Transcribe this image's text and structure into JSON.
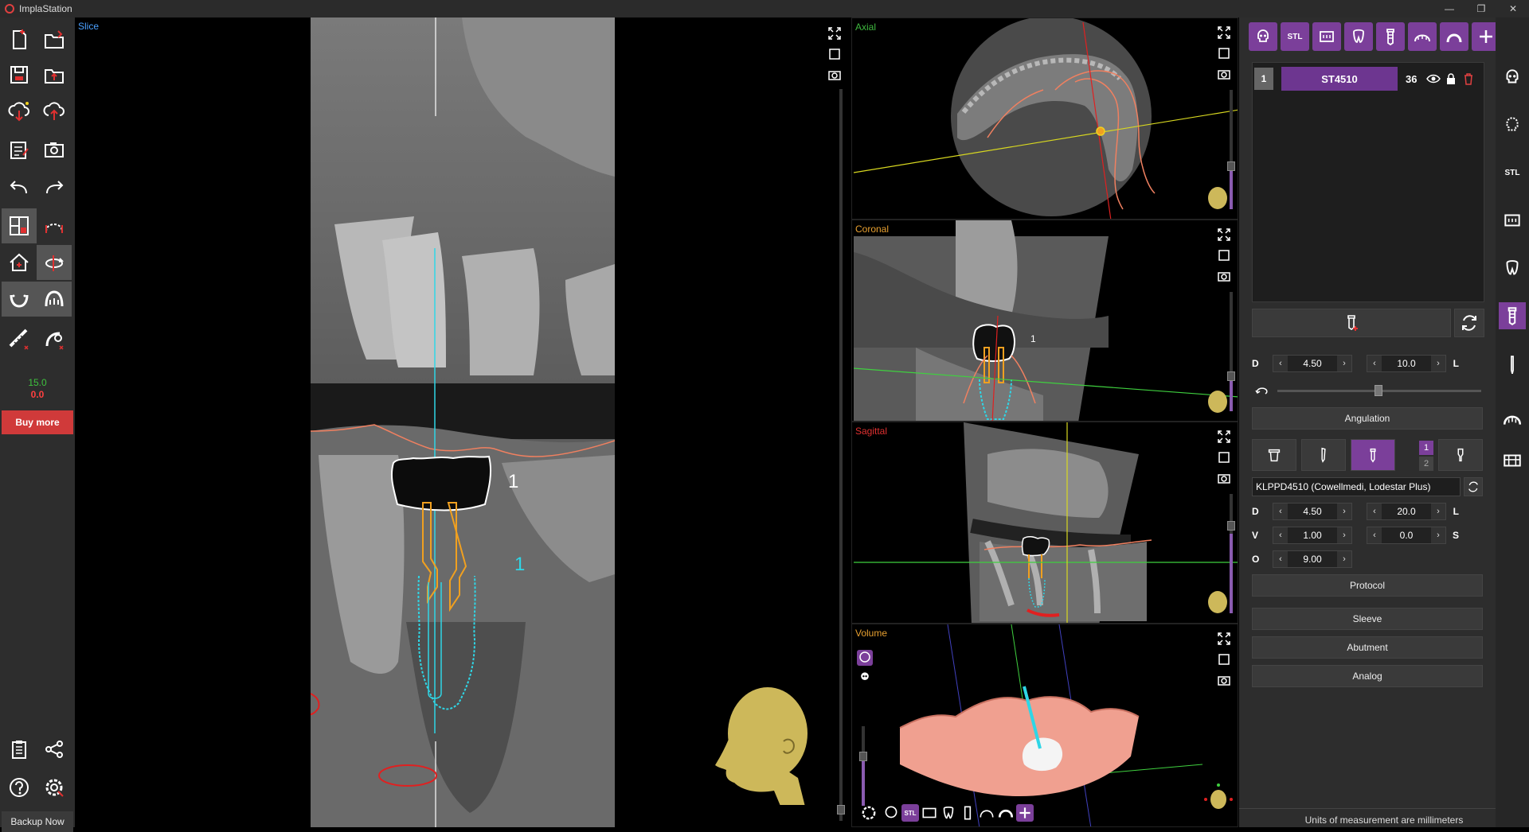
{
  "app": {
    "title": "ImplaStation"
  },
  "window_controls": {
    "minimize": "—",
    "restore": "❐",
    "close": "✕"
  },
  "left_toolbar": {
    "counter_green": "15.0",
    "counter_red": "0.0",
    "buy_more": "Buy more",
    "backup_now": "Backup Now"
  },
  "views": {
    "slice": {
      "label": "Slice",
      "implant_number": "1",
      "crown_number": "1"
    },
    "axial": {
      "label": "Axial"
    },
    "coronal": {
      "label": "Coronal",
      "crown_number": "1"
    },
    "sagittal": {
      "label": "Sagittal"
    },
    "volume": {
      "label": "Volume"
    }
  },
  "colors": {
    "accent": "#7b3f9a",
    "axial_label": "#3fb83f",
    "coronal_label": "#e8a030",
    "sagittal_label": "#e03030",
    "volume_label": "#e8a030",
    "slice_label": "#4aa0ff",
    "implant_cyan": "#2fd6e6",
    "abutment_orange": "#f0a020",
    "nerve_red": "#e02020"
  },
  "right_panel": {
    "top_icons": [
      "skull-icon",
      "stl-icon",
      "teeth-scan-icon",
      "tooth-icon",
      "implant-icon",
      "arch-icon",
      "guide-icon",
      "add-icon",
      "list-icon"
    ],
    "stl_label": "STL",
    "implant_list": [
      {
        "index": "1",
        "name": "ST4510",
        "tooth": "36"
      }
    ],
    "d1_label": "D",
    "d1_value": "4.50",
    "l1_label": "L",
    "l1_value": "10.0",
    "angulation": "Angulation",
    "page_1": "1",
    "page_2": "2",
    "model": "KLPPD4510 (Cowellmedi, Lodestar Plus)",
    "d2_label": "D",
    "d2_value": "4.50",
    "l2_label": "L",
    "l2_value": "20.0",
    "v_label": "V",
    "v_value": "1.00",
    "s_label": "S",
    "s_value": "0.0",
    "o_label": "O",
    "o_value": "9.00",
    "protocol": "Protocol",
    "sleeve": "Sleeve",
    "abutment": "Abutment",
    "analog": "Analog",
    "units_note": "Units of measurement are millimeters"
  },
  "right_sidebar": {
    "stl_label": "STL"
  }
}
